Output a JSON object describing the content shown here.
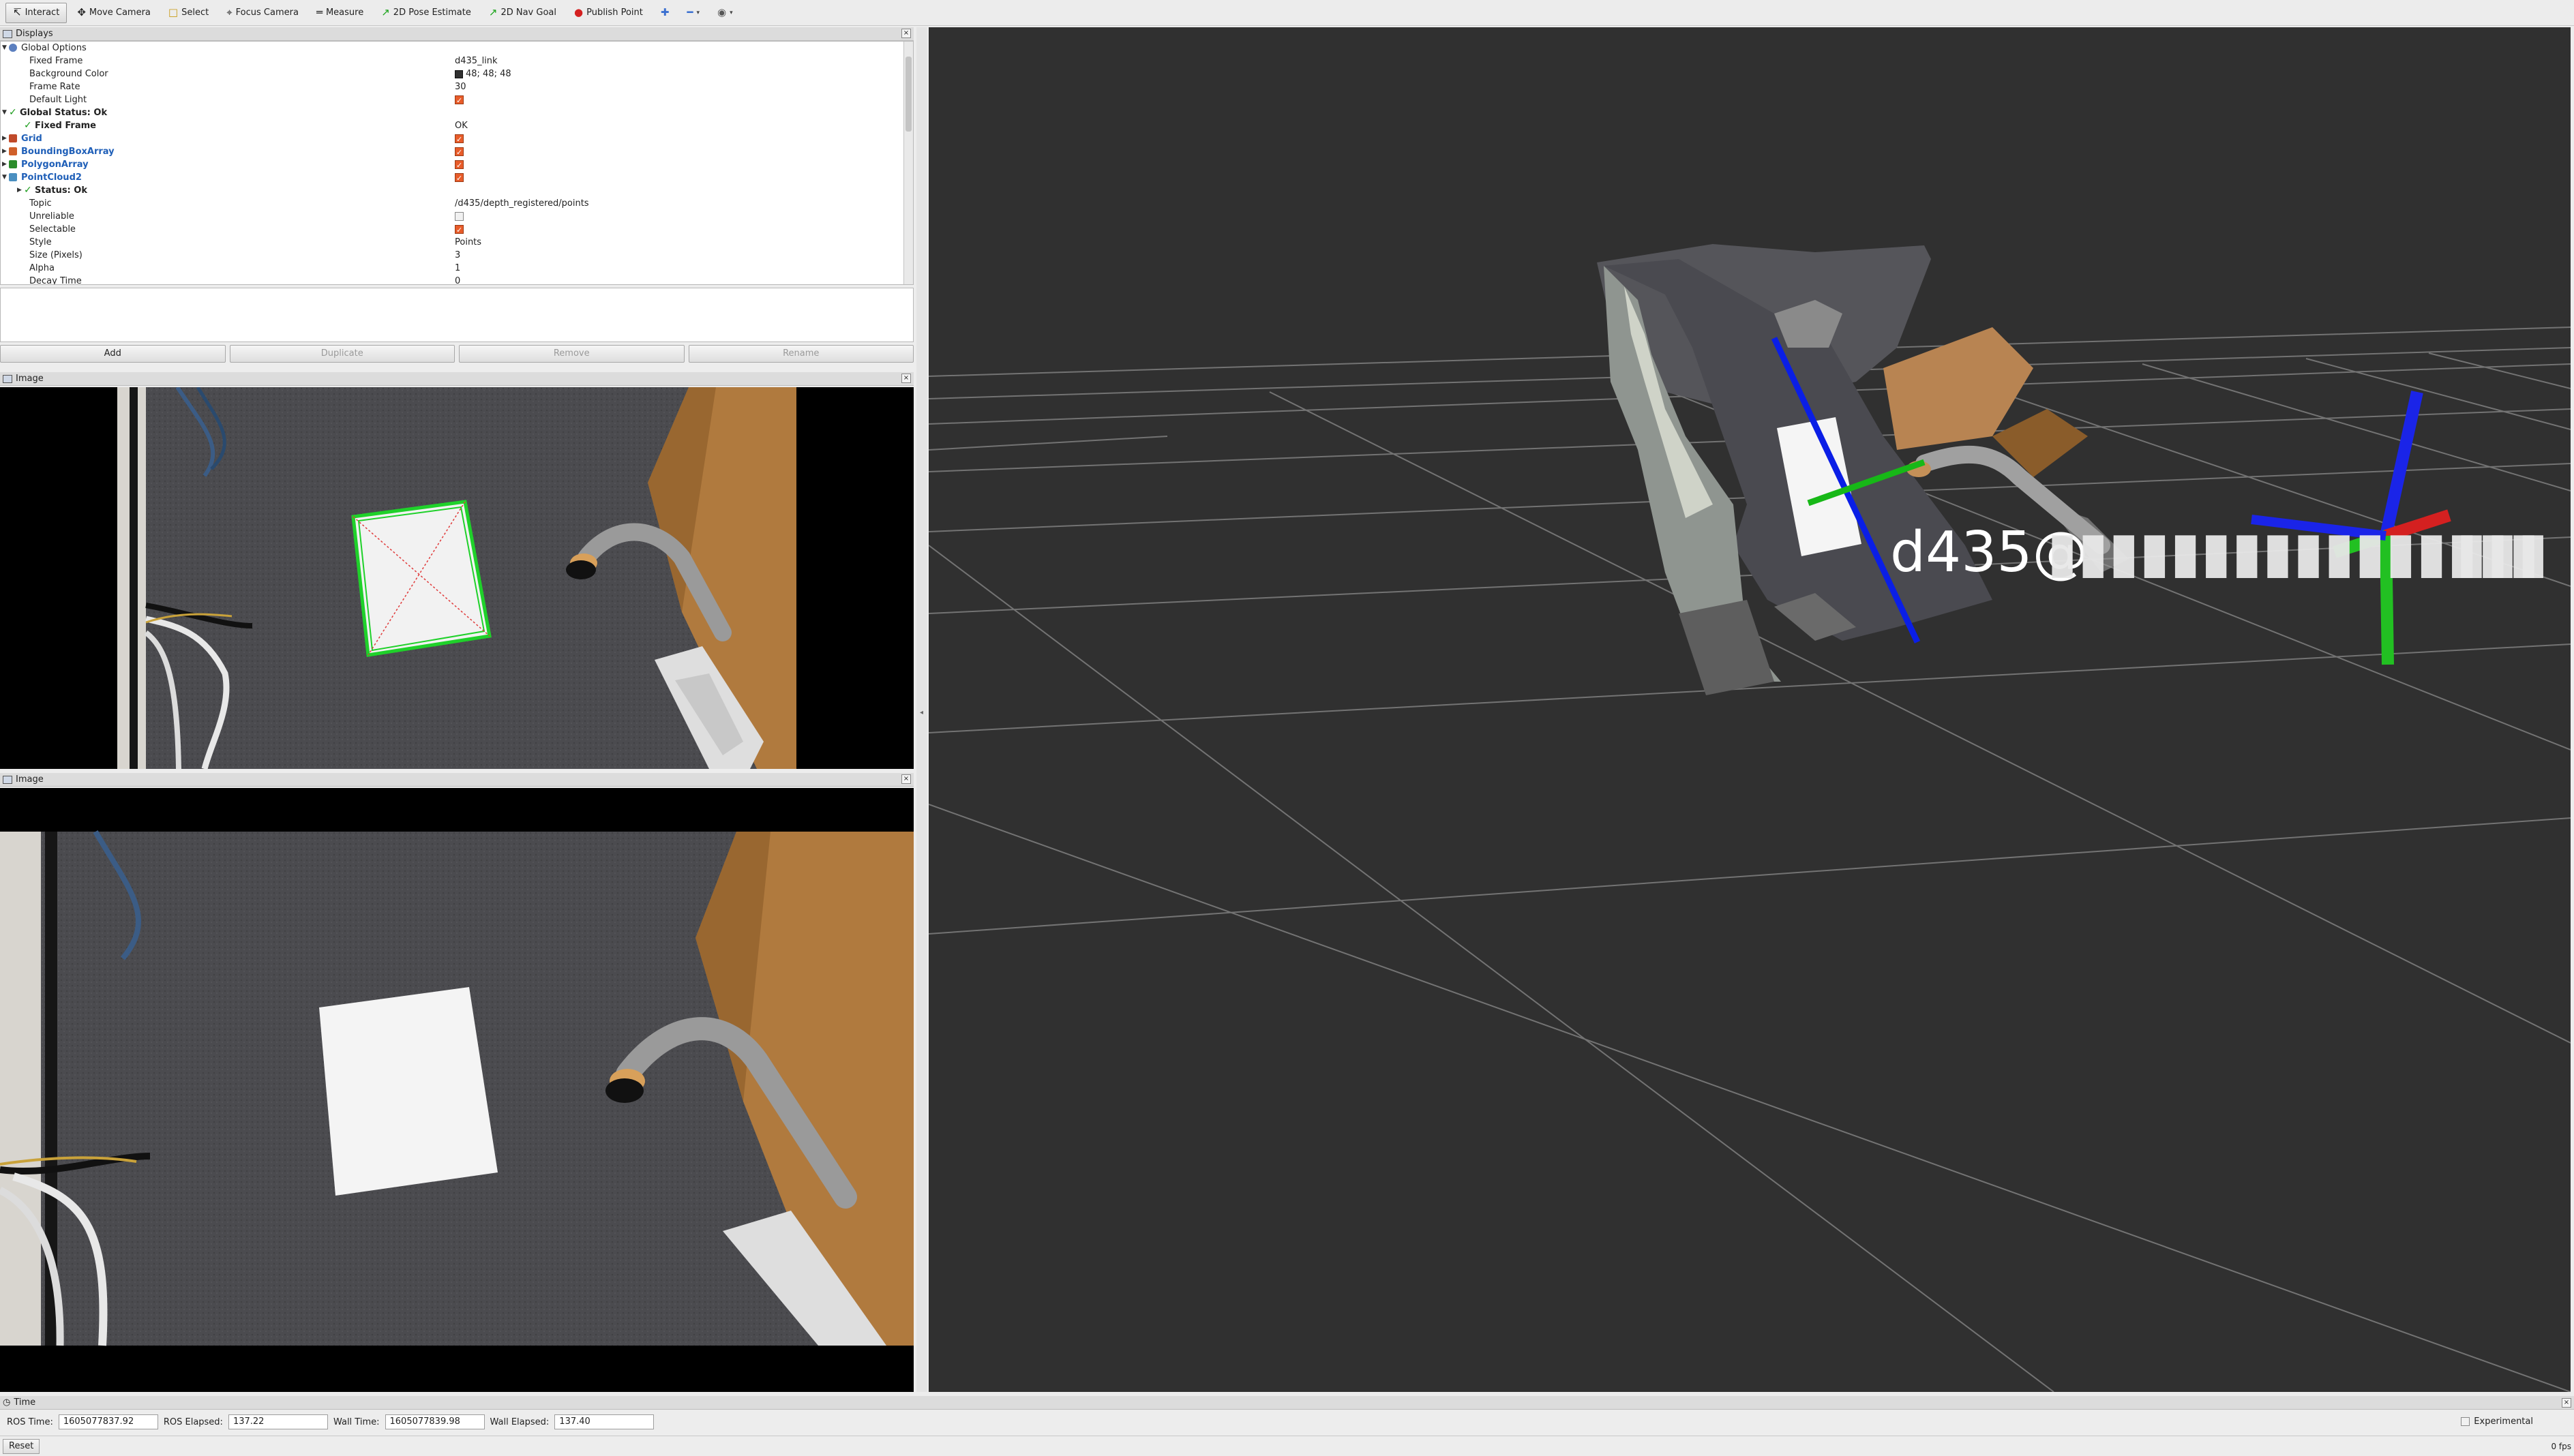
{
  "toolbar": {
    "tools": [
      {
        "label": "Interact",
        "icon": "interact-icon",
        "glyph": "↸",
        "active": true
      },
      {
        "label": "Move Camera",
        "icon": "move-camera-icon",
        "glyph": "✥"
      },
      {
        "label": "Select",
        "icon": "select-icon",
        "glyph": "□"
      },
      {
        "label": "Focus Camera",
        "icon": "focus-camera-icon",
        "glyph": "⌖"
      },
      {
        "label": "Measure",
        "icon": "measure-icon",
        "glyph": "═"
      },
      {
        "label": "2D Pose Estimate",
        "icon": "pose-estimate-icon",
        "glyph": "↗"
      },
      {
        "label": "2D Nav Goal",
        "icon": "nav-goal-icon",
        "glyph": "↗"
      },
      {
        "label": "Publish Point",
        "icon": "publish-point-icon",
        "glyph": "●"
      }
    ],
    "extra_icons": [
      "add-tool-icon",
      "remove-tool-icon",
      "camera-type-icon"
    ]
  },
  "displays": {
    "title": "Displays",
    "rows": [
      {
        "label": "Global Options",
        "value": "",
        "indent": 1,
        "arrow": "down",
        "icon": "gear"
      },
      {
        "label": "Fixed Frame",
        "value": "d435_link",
        "indent": 2
      },
      {
        "label": "Background Color",
        "value": "48; 48; 48",
        "indent": 2,
        "swatch": true
      },
      {
        "label": "Frame Rate",
        "value": "30",
        "indent": 2
      },
      {
        "label": "Default Light",
        "value": "",
        "indent": 2,
        "checkbox": true
      },
      {
        "label": "Global Status: Ok",
        "value": "",
        "indent": 1,
        "arrow": "down",
        "check": true
      },
      {
        "label": "Fixed Frame",
        "value": "OK",
        "indent": 2,
        "check": true
      },
      {
        "label": "Grid",
        "value": "",
        "indent": 1,
        "arrow": "right",
        "blue": true,
        "checkbox": true,
        "icon": "grid"
      },
      {
        "label": "BoundingBoxArray",
        "value": "",
        "indent": 1,
        "arrow": "right",
        "blue": true,
        "checkbox": true,
        "icon": "bbox"
      },
      {
        "label": "PolygonArray",
        "value": "",
        "indent": 1,
        "arrow": "right",
        "blue": true,
        "checkbox": true,
        "icon": "polygon"
      },
      {
        "label": "PointCloud2",
        "value": "",
        "indent": 1,
        "arrow": "down",
        "blue": true,
        "checkbox": true,
        "icon": "cloud"
      },
      {
        "label": "Status: Ok",
        "value": "",
        "indent": 2,
        "arrow": "right",
        "check": true
      },
      {
        "label": "Topic",
        "value": "/d435/depth_registered/points",
        "indent": 2
      },
      {
        "label": "Unreliable",
        "value": "",
        "indent": 2,
        "checkbox_off": true
      },
      {
        "label": "Selectable",
        "value": "",
        "indent": 2,
        "checkbox": true
      },
      {
        "label": "Style",
        "value": "Points",
        "indent": 2
      },
      {
        "label": "Size (Pixels)",
        "value": "3",
        "indent": 2
      },
      {
        "label": "Alpha",
        "value": "1",
        "indent": 2
      },
      {
        "label": "Decay Time",
        "value": "0",
        "indent": 2
      }
    ],
    "buttons": {
      "add": "Add",
      "duplicate": "Duplicate",
      "remove": "Remove",
      "rename": "Rename"
    }
  },
  "image_panels": [
    {
      "title": "Image"
    },
    {
      "title": "Image"
    }
  ],
  "view3d": {
    "frame_label": "d435@",
    "background": "#303030"
  },
  "time": {
    "title": "Time",
    "ros_time_label": "ROS Time:",
    "ros_time": "1605077837.92",
    "ros_elapsed_label": "ROS Elapsed:",
    "ros_elapsed": "137.22",
    "wall_time_label": "Wall Time:",
    "wall_time": "1605077839.98",
    "wall_elapsed_label": "Wall Elapsed:",
    "wall_elapsed": "137.40",
    "experimental": "Experimental",
    "reset": "Reset",
    "fps": "0 fps"
  }
}
